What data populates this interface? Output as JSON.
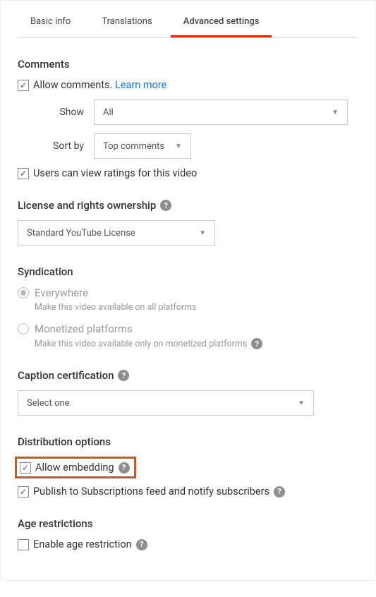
{
  "tabs": {
    "basic": "Basic info",
    "translations": "Translations",
    "advanced": "Advanced settings"
  },
  "comments": {
    "title": "Comments",
    "allow": "Allow comments.",
    "learn_more": "Learn more",
    "show_label": "Show",
    "show_value": "All",
    "sort_label": "Sort by",
    "sort_value": "Top comments",
    "ratings": "Users can view ratings for this video"
  },
  "license": {
    "title": "License and rights ownership",
    "value": "Standard YouTube License"
  },
  "syndication": {
    "title": "Syndication",
    "everywhere": "Everywhere",
    "everywhere_desc": "Make this video available on all platforms",
    "monetized": "Monetized platforms",
    "monetized_desc": "Make this video available only on monetized platforms"
  },
  "caption": {
    "title": "Caption certification",
    "value": "Select one"
  },
  "distribution": {
    "title": "Distribution options",
    "embedding": "Allow embedding",
    "publish": "Publish to Subscriptions feed and notify subscribers"
  },
  "age": {
    "title": "Age restrictions",
    "enable": "Enable age restriction"
  },
  "help": "?"
}
